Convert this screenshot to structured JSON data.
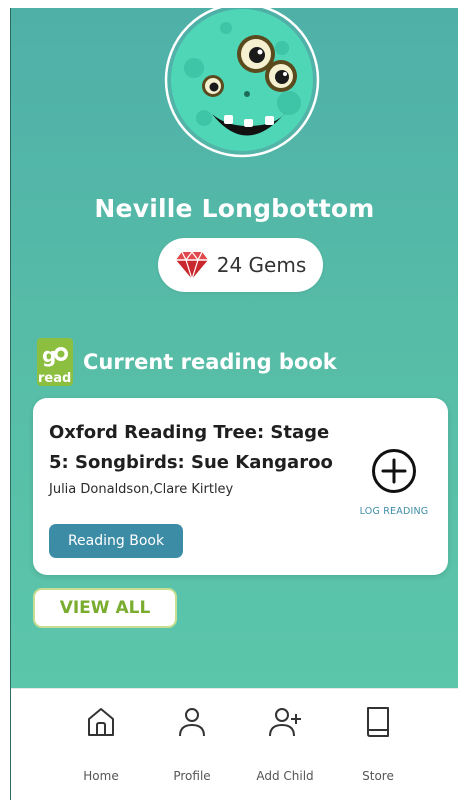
{
  "profile": {
    "name": "Neville Longbottom",
    "gems_label": "24 Gems",
    "gems_count": 24
  },
  "section": {
    "logo_text": "go read",
    "title": "Current reading book"
  },
  "book": {
    "title": "Oxford Reading Tree: Stage 5: Songbirds: Sue Kangaroo",
    "authors": "Julia Donaldson,Clare Kirtley",
    "tag": "Reading Book",
    "log_label": "LOG READING"
  },
  "view_all_label": "VIEW ALL",
  "nav": {
    "items": [
      {
        "label": "Home",
        "icon": "home-icon"
      },
      {
        "label": "Profile",
        "icon": "person-icon"
      },
      {
        "label": "Add Child",
        "icon": "add-person-icon"
      },
      {
        "label": "Store",
        "icon": "book-icon"
      }
    ]
  },
  "colors": {
    "background_top": "#4fb0a8",
    "background_bottom": "#5dc9ac",
    "accent_blue": "#3d8ca6",
    "accent_green": "#7aad2f",
    "gem_red": "#c8272d"
  }
}
